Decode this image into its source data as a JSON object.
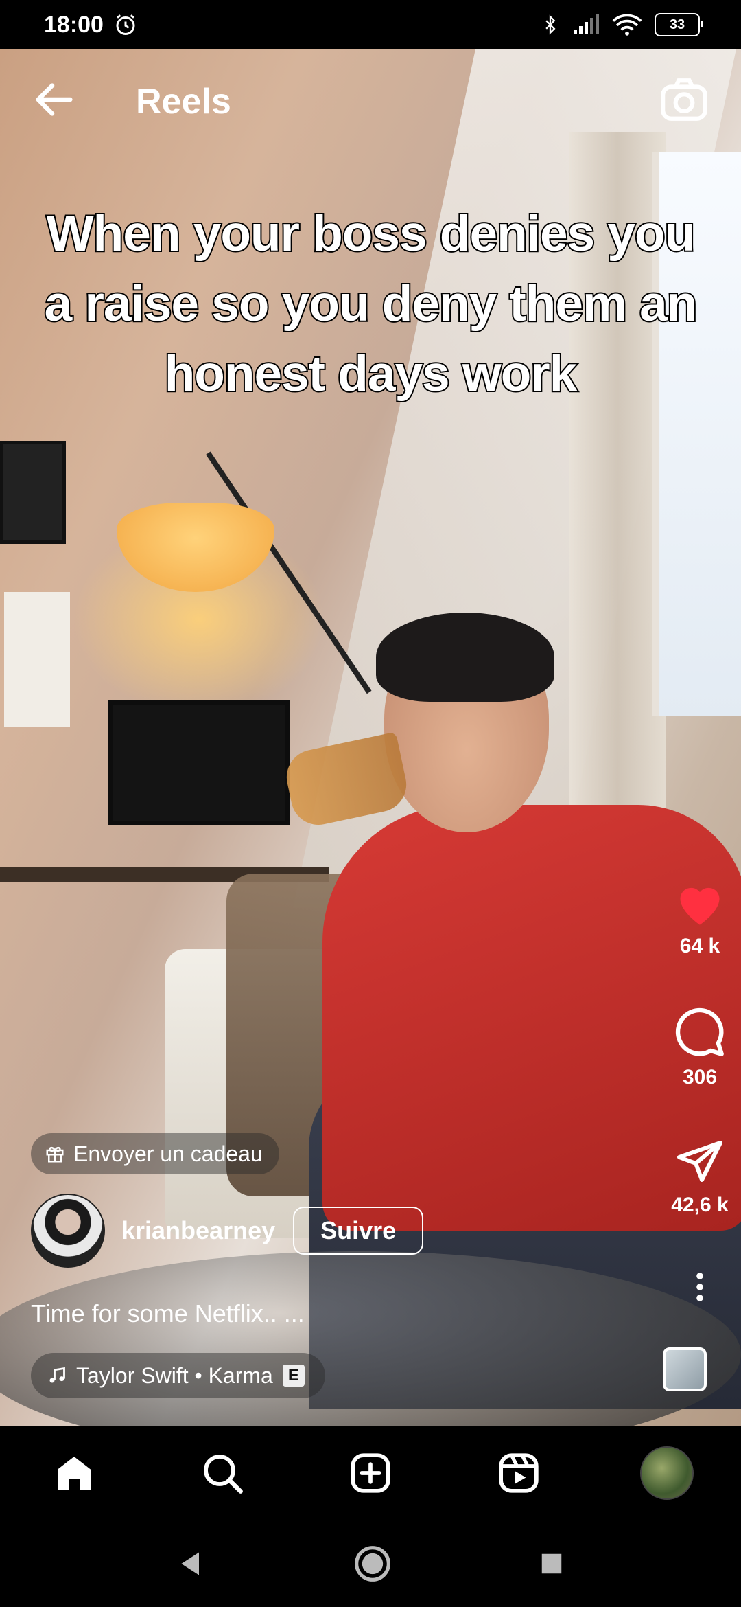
{
  "status_bar": {
    "time": "18:00",
    "battery": "33"
  },
  "header": {
    "title": "Reels"
  },
  "video": {
    "caption": "When your boss denies you a raise so you deny them an honest days work"
  },
  "actions": {
    "likes": "64 k",
    "comments": "306",
    "shares": "42,6 k"
  },
  "gift": {
    "label": "Envoyer un cadeau"
  },
  "author": {
    "username": "krianbearney",
    "follow_label": "Suivre"
  },
  "description": "Time for some Netflix.. ...",
  "music": {
    "text": "Taylor Swift • Karma",
    "explicit_badge": "E"
  },
  "colors": {
    "like_red": "#ff3040",
    "bg": "#000000"
  },
  "icons": [
    "back-arrow-icon",
    "camera-icon",
    "heart-icon",
    "comment-icon",
    "send-icon",
    "more-vertical-icon",
    "music-note-icon",
    "gift-icon",
    "home-icon",
    "search-icon",
    "add-icon",
    "reels-icon",
    "profile-avatar",
    "back-triangle-icon",
    "home-circle-icon",
    "recents-square-icon"
  ]
}
